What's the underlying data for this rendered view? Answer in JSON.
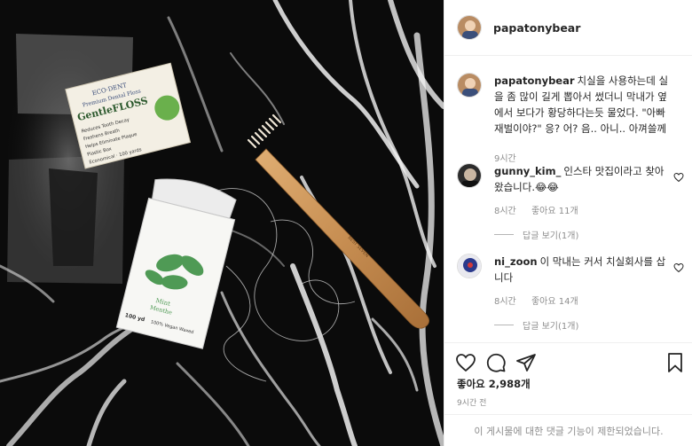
{
  "post": {
    "username": "papatonybear",
    "caption_text": "치실을 사용하는데 실을 좀 많이 길게 뽑아서 썼더니 막내가 옆에서 보다가 황당하다는듯 물었다. \"아빠 재벌이야?\" 응? 어? 음.. 아니.. 아껴쓸께",
    "caption_time": "9시간"
  },
  "photo": {
    "floss_box": {
      "brand": "ECO·DENT",
      "product": "Premium Dental Floss",
      "name": "GentleFLOSS",
      "features": [
        "Reduces Tooth Decay",
        "Freshens Breath",
        "Helps Eliminate Plaque",
        "Plastic Box",
        "Economical · 100 yards"
      ]
    },
    "floss_pack": {
      "flavor": "Mint",
      "flavor_fr": "Menthe",
      "length": "100 yd",
      "claim": "100% Vegan Waxed"
    },
    "toothbrush_text": "BEST SEVEN"
  },
  "comments": [
    {
      "username": "gunny_kim_",
      "text": "인스타 맛집이라고 찾아 왔습니다.😂😂",
      "time": "8시간",
      "likes": "좋아요 11개",
      "replies": "답글 보기(1개)"
    },
    {
      "username": "ni_zoon",
      "text": "이 막내는 커서 치실회사를 삽니다",
      "time": "8시간",
      "likes": "좋아요 14개",
      "replies": "답글 보기(1개)"
    }
  ],
  "footer": {
    "likes_count": "좋아요 2,988개",
    "time_ago": "9시간 전",
    "comments_limited": "이 게시물에 대한 댓글 기능이 제한되었습니다."
  },
  "colors": {
    "text": "#262626",
    "muted": "#8e8e8e",
    "border": "#efefef",
    "marble": "#0b0b0b",
    "vein": "#f2f2f2",
    "bamboo": "#c9945a",
    "leaf": "#4f9a55"
  }
}
